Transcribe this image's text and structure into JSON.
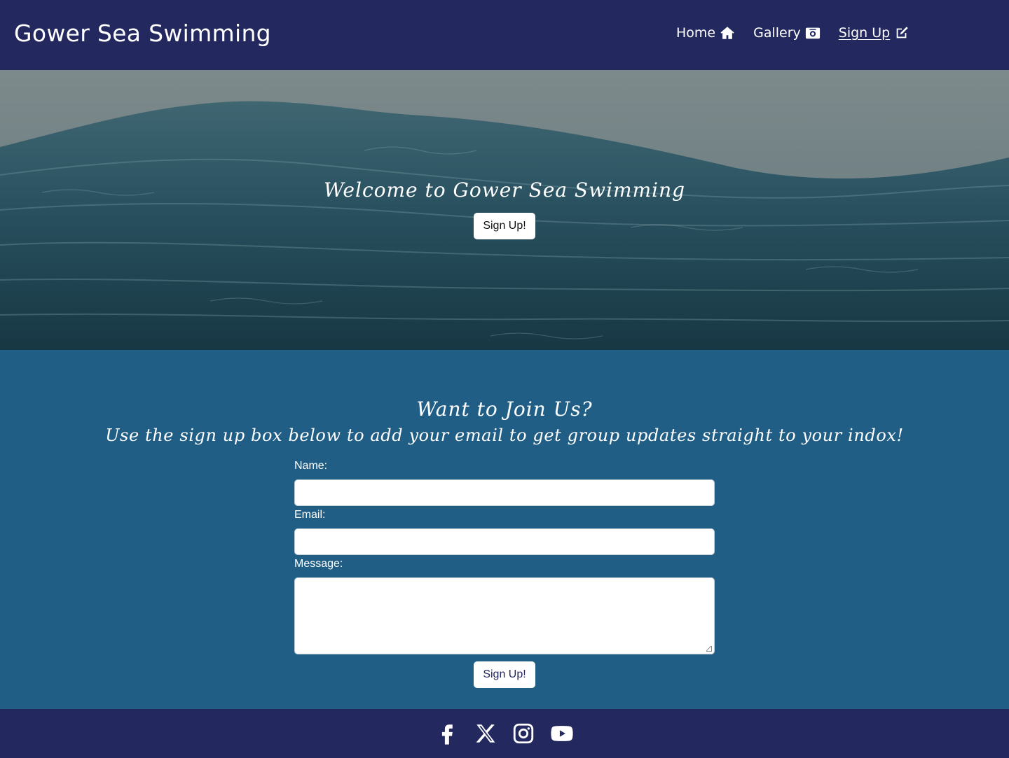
{
  "header": {
    "brand": "Gower Sea Swimming",
    "nav": [
      {
        "label": "Home",
        "icon": "home-icon"
      },
      {
        "label": "Gallery",
        "icon": "camera-icon"
      },
      {
        "label": "Sign Up",
        "icon": "edit-icon",
        "active": true
      }
    ]
  },
  "hero": {
    "title": "Welcome to Gower Sea Swimming",
    "button_label": "Sign Up!"
  },
  "signup": {
    "title": "Want to Join Us?",
    "subtitle": "Use the sign up box below to add your email to get group updates straight to your indox!",
    "name_label": "Name:",
    "name_value": "",
    "email_label": "Email:",
    "email_value": "",
    "message_label": "Message:",
    "message_value": "",
    "submit_label": "Sign Up!"
  },
  "footer": {
    "social": [
      "facebook-icon",
      "x-twitter-icon",
      "instagram-icon",
      "youtube-icon"
    ]
  },
  "colors": {
    "header_bg": "#23285f",
    "section_bg": "#215e86",
    "footer_bg": "#23285f"
  }
}
